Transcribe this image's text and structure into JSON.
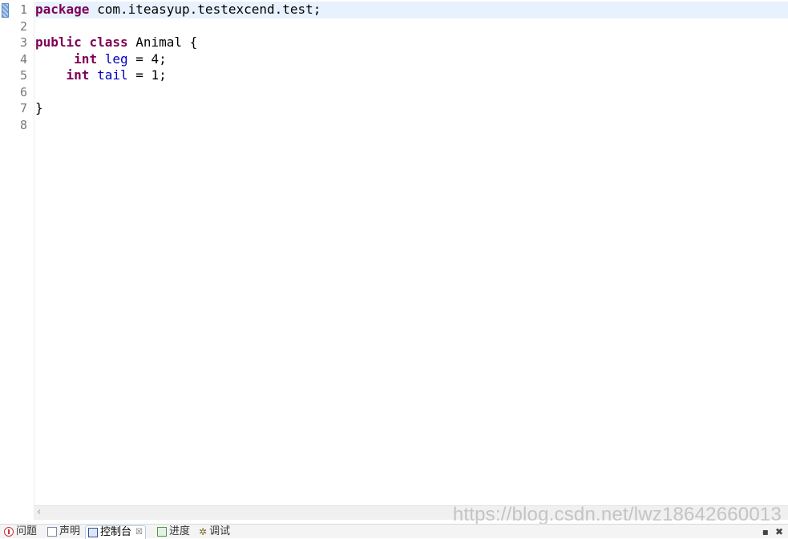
{
  "editor": {
    "line_numbers": [
      "1",
      "2",
      "3",
      "4",
      "5",
      "6",
      "7",
      "8"
    ],
    "lines": [
      [
        {
          "t": "package",
          "k": "kw"
        },
        {
          "t": " com.iteasyup.testexcend.test;",
          "k": ""
        }
      ],
      [],
      [
        {
          "t": "public",
          "k": "kw"
        },
        {
          "t": " ",
          "k": ""
        },
        {
          "t": "class",
          "k": "kw"
        },
        {
          "t": " Animal {",
          "k": ""
        }
      ],
      [
        {
          "t": "     ",
          "k": ""
        },
        {
          "t": "int",
          "k": "kw"
        },
        {
          "t": " ",
          "k": ""
        },
        {
          "t": "leg",
          "k": "fld"
        },
        {
          "t": " = 4;",
          "k": ""
        }
      ],
      [
        {
          "t": "    ",
          "k": ""
        },
        {
          "t": "int",
          "k": "kw"
        },
        {
          "t": " ",
          "k": ""
        },
        {
          "t": "tail",
          "k": "fld"
        },
        {
          "t": " = 1;",
          "k": ""
        }
      ],
      [],
      [
        {
          "t": "}",
          "k": ""
        }
      ],
      []
    ],
    "colors": {
      "keyword": "#7f0055",
      "field": "#0000c0",
      "current_line": "#e8f2fe"
    }
  },
  "scrollbar": {
    "left_arrow": "‹"
  },
  "watermark": "https://blog.csdn.net/lwz18642660013",
  "bottom_tabs": {
    "problems": {
      "label": "问题",
      "icon": "problems-icon"
    },
    "declaration": {
      "label": "声明",
      "icon": "declaration-icon"
    },
    "console": {
      "label": "控制台",
      "icon": "console-icon",
      "close": "☒"
    },
    "progress": {
      "label": "进度",
      "icon": "progress-icon"
    },
    "debug": {
      "label": "调试",
      "icon": "debug-icon"
    }
  },
  "view_controls": {
    "minimize": "▪",
    "close": "✖"
  }
}
